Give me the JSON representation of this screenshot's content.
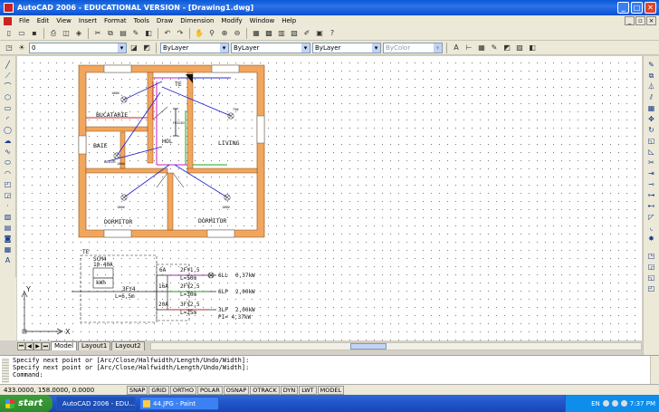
{
  "window": {
    "title": "AutoCAD 2006 - EDUCATIONAL VERSION - [Drawing1.dwg]",
    "controls": [
      "_",
      "□",
      "✕"
    ]
  },
  "menu": [
    "File",
    "Edit",
    "View",
    "Insert",
    "Format",
    "Tools",
    "Draw",
    "Dimension",
    "Modify",
    "Window",
    "Help"
  ],
  "layers": {
    "current": "0"
  },
  "properties": {
    "color": "ByLayer",
    "linetype": "ByLayer",
    "lineweight": "ByLayer",
    "plotstyle": "ByColor"
  },
  "drawing": {
    "rooms": [
      "BUCATARIE",
      "BAIE",
      "HOL",
      "LIVING",
      "DORMITOR",
      "DORMITOR"
    ],
    "te_top": "TE",
    "labels_small": [
      "FRIGID",
      "BOILER"
    ],
    "fixtures": [
      "100W",
      "75W",
      "100W",
      "100W",
      "100W"
    ],
    "schema": {
      "te": "TE",
      "meter_title": "SCM4",
      "meter_rating": "10-40A",
      "meter_unit": "kWh",
      "feeder": "3FY4",
      "feeder_len": "L=6,5m",
      "circuits": [
        {
          "fuse": "6A",
          "cable": "2FY1,5",
          "length": "L=50m",
          "name": "6LL",
          "power": "0,37kW"
        },
        {
          "fuse": "16A",
          "cable": "2FY2,5",
          "length": "L=30m",
          "name": "6LP",
          "power": "2,00kW"
        },
        {
          "fuse": "20A",
          "cable": "3FY2,5",
          "length": "L=25m",
          "name": "3LP",
          "power": "2,00kW"
        }
      ],
      "total": "PI= 4,37kW"
    },
    "ucs": {
      "x": "X",
      "y": "Y"
    }
  },
  "tabs": [
    "Model",
    "Layout1",
    "Layout2"
  ],
  "command": {
    "history": [
      "Specify next point or [Arc/Close/Halfwidth/Length/Undo/Width]:",
      "Specify next point or [Arc/Close/Halfwidth/Length/Undo/Width]:"
    ],
    "prompt": "Command:"
  },
  "status": {
    "coords": "433.0000, 158.0000, 0.0000",
    "toggles": [
      "SNAP",
      "GRID",
      "ORTHO",
      "POLAR",
      "OSNAP",
      "OTRACK",
      "DYN",
      "LWT",
      "MODEL"
    ]
  },
  "taskbar": {
    "start": "start",
    "items": [
      "AutoCAD 2006 - EDU...",
      "44.JPG - Paint"
    ],
    "lang": "EN",
    "clock": "7:37 PM"
  },
  "colors": {
    "wall": "#f1a65e",
    "titlebar": "#0a58d6",
    "circuit_blue": "#2a2ad0",
    "circuit_green": "#1aa81a",
    "circuit_magenta": "#c020c0",
    "circuit_red": "#d02020"
  }
}
